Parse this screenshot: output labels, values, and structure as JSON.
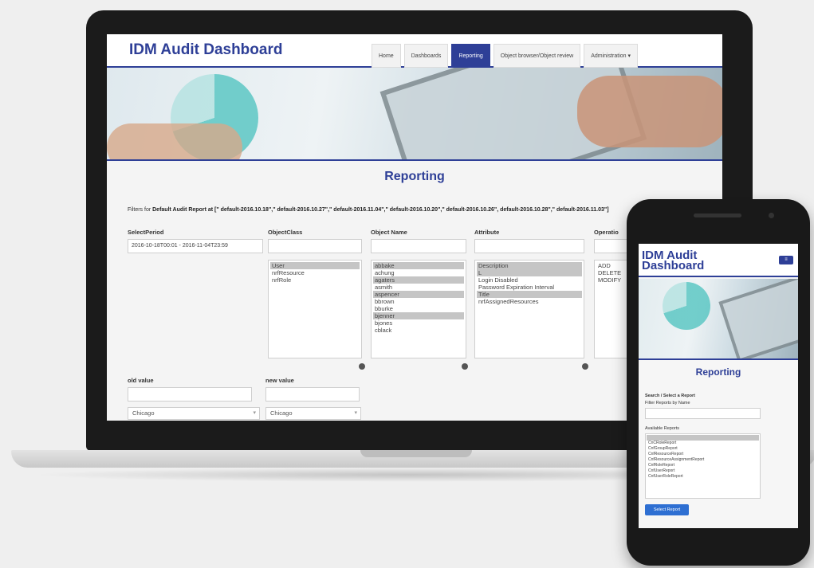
{
  "app": {
    "title": "IDM Audit Dashboard"
  },
  "nav": [
    {
      "label": "Home",
      "active": false
    },
    {
      "label": "Dashboards",
      "active": false
    },
    {
      "label": "Reporting",
      "active": true
    },
    {
      "label": "Object browser/Object review",
      "active": false
    },
    {
      "label": "Administration ▾",
      "active": false
    }
  ],
  "page": {
    "heading": "Reporting",
    "filter_prefix": "Filters for ",
    "filter_report": "Default Audit Report",
    "filter_rest": " at [\" default-2016.10.18\",\" default-2016.10.27\",\" default-2016.11.04\",\" default-2016.10.20\",\" default-2016.10.26\", default-2016.10.28\",\" default-2016.11.03\"]"
  },
  "filters": {
    "period": {
      "label": "SelectPeriod",
      "value": "2016-10-18T00:01 - 2016-11-04T23:59"
    },
    "objectclass": {
      "label": "ObjectClass",
      "items": [
        {
          "text": "User",
          "selected": true
        },
        {
          "text": "nrfResource",
          "selected": false
        },
        {
          "text": "nrfRole",
          "selected": false
        }
      ]
    },
    "objectname": {
      "label": "Object Name",
      "items": [
        {
          "text": "abbake",
          "selected": true
        },
        {
          "text": "achung",
          "selected": false
        },
        {
          "text": "agaters",
          "selected": true
        },
        {
          "text": "asmith",
          "selected": false
        },
        {
          "text": "aspencer",
          "selected": true
        },
        {
          "text": "bbrown",
          "selected": false
        },
        {
          "text": "bburke",
          "selected": false
        },
        {
          "text": "bjenner",
          "selected": true
        },
        {
          "text": "bjones",
          "selected": false
        },
        {
          "text": "cblack",
          "selected": false
        }
      ]
    },
    "attribute": {
      "label": "Attribute",
      "items": [
        {
          "text": "Description",
          "selected": true
        },
        {
          "text": "L",
          "selected": true
        },
        {
          "text": "Login Disabled",
          "selected": false
        },
        {
          "text": "Password Expiration Interval",
          "selected": false
        },
        {
          "text": "Title",
          "selected": true
        },
        {
          "text": "nrfAssignedResources",
          "selected": false
        }
      ]
    },
    "operation": {
      "label": "Operatio",
      "items": [
        {
          "text": "ADD",
          "selected": false
        },
        {
          "text": "DELETE",
          "selected": false
        },
        {
          "text": "MODIFY",
          "selected": false
        }
      ]
    },
    "old_value": {
      "label": "old value",
      "select": "Chicago"
    },
    "new_value": {
      "label": "new value",
      "select": "Chicago"
    }
  },
  "mobile": {
    "title": "IDM Audit Dashboard",
    "menu_label": "≡",
    "heading": "Reporting",
    "search_label": "Search / Select a Report",
    "filter_label": "Filter Reports by Name",
    "available_label": "Available Reports",
    "reports": [
      {
        "text": "",
        "selected": true
      },
      {
        "text": "CnCRoleReport",
        "selected": false
      },
      {
        "text": "CnfGroupReport",
        "selected": false
      },
      {
        "text": "CnfResourceReport",
        "selected": false
      },
      {
        "text": "CnfResourceAssignmentReport",
        "selected": false
      },
      {
        "text": "CnfRoleReport",
        "selected": false
      },
      {
        "text": "CnfUserReport",
        "selected": false
      },
      {
        "text": "CnfUserRoleReport",
        "selected": false
      }
    ],
    "button_label": "Select Report"
  },
  "colors": {
    "brand": "#2e3f97",
    "accent_button": "#2e6fd2",
    "selected_row": "#c5c5c5"
  }
}
